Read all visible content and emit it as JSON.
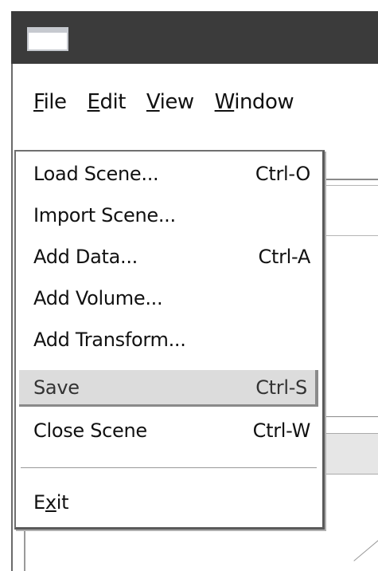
{
  "menubar": {
    "items": [
      {
        "label": "File",
        "mnemonic_index": 0
      },
      {
        "label": "Edit",
        "mnemonic_index": 0
      },
      {
        "label": "View",
        "mnemonic_index": 0
      },
      {
        "label": "Window",
        "mnemonic_index": 0
      }
    ]
  },
  "file_menu": {
    "items": [
      {
        "label": "Load Scene...",
        "shortcut": "Ctrl-O"
      },
      {
        "label": "Import Scene...",
        "shortcut": ""
      },
      {
        "label": "Add Data...",
        "shortcut": "Ctrl-A"
      },
      {
        "label": "Add Volume...",
        "shortcut": ""
      },
      {
        "label": "Add Transform...",
        "shortcut": ""
      },
      {
        "label": "Save",
        "shortcut": "Ctrl-S",
        "highlighted": true
      },
      {
        "label": "Close Scene",
        "shortcut": "Ctrl-W"
      },
      {
        "label": "Exit",
        "shortcut": "",
        "mnemonic_index": 1
      }
    ]
  },
  "colors": {
    "titlebar": "#3b3b3b",
    "highlight": "#dcdcdc"
  },
  "icons": {
    "window_icon": "window-icon"
  }
}
